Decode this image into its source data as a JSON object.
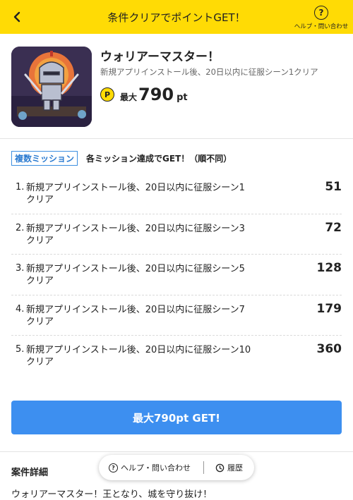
{
  "header": {
    "title": "条件クリアでポイントGET！",
    "help_label": "ヘルプ・問い合わせ",
    "help_glyph": "?",
    "back_icon": "chevron-left-icon"
  },
  "app": {
    "name": "ウォリアーマスター！",
    "description": "新規アプリインストール後、20日以内に征服シーン1クリア",
    "max_label": "最大",
    "max_points": "790",
    "unit": "pt",
    "coin_glyph": "P"
  },
  "missions": {
    "badge": "複数ミッション",
    "subtitle": "各ミッション達成でGET！（順不同）",
    "items": [
      {
        "index": "1.",
        "text": "新規アプリインストール後、20日以内に征服シーン1クリア",
        "points": "51"
      },
      {
        "index": "2.",
        "text": "新規アプリインストール後、20日以内に征服シーン3クリア",
        "points": "72"
      },
      {
        "index": "3.",
        "text": "新規アプリインストール後、20日以内に征服シーン5クリア",
        "points": "128"
      },
      {
        "index": "4.",
        "text": "新規アプリインストール後、20日以内に征服シーン7クリア",
        "points": "179"
      },
      {
        "index": "5.",
        "text": "新規アプリインストール後、20日以内に征服シーン10クリア",
        "points": "360"
      }
    ]
  },
  "cta": {
    "label": "最大790pt GET!"
  },
  "details": {
    "title": "案件詳細",
    "text": "ウォリアーマスター！王となり、城を守り抜け！"
  },
  "floating_bar": {
    "help_label": "ヘルプ・問い合わせ",
    "history_label": "履歴"
  },
  "colors": {
    "header_bg": "#ffdb05",
    "accent_blue": "#3d8ff0",
    "coin_yellow": "#ffdb05"
  }
}
